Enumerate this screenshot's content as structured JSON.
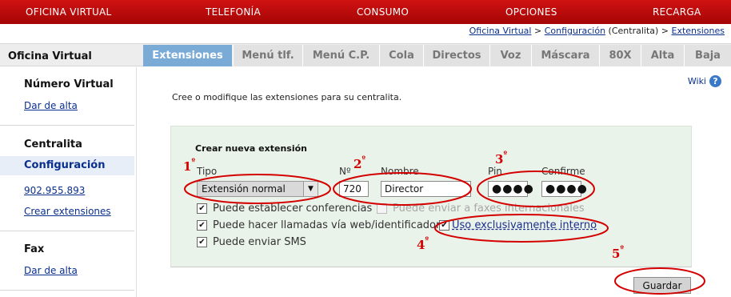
{
  "topnav": [
    "OFICINA VIRTUAL",
    "TELEFONÍA",
    "CONSUMO",
    "OPCIONES",
    "RECARGA"
  ],
  "breadcrumb": {
    "oficina": "Oficina Virtual",
    "sep1": " > ",
    "config": "Configuración",
    "centralita": " (Centralita) > ",
    "extensiones": "Extensiones"
  },
  "sidebar": {
    "title": "Oficina Virtual",
    "numero_virtual": "Número Virtual",
    "dar_alta_1": "Dar de alta",
    "centralita": "Centralita",
    "configuracion": "Configuración",
    "phone": "902.955.893",
    "crear_ext": "Crear extensiones",
    "fax": "Fax",
    "dar_alta_2": "Dar de alta"
  },
  "tabs": [
    "Extensiones",
    "Menú tlf.",
    "Menú C.P.",
    "Cola",
    "Directos",
    "Voz",
    "Máscara",
    "80X",
    "Alta",
    "Baja"
  ],
  "content": {
    "wiki": "Wiki",
    "intro": "Cree o modifique las extensiones para su centralita.",
    "panel_title": "Crear nueva extensión"
  },
  "form": {
    "tipo_label": "Tipo",
    "tipo_value": "Extensión normal",
    "num_label": "Nº",
    "num_value": "720",
    "nombre_label": "Nombre",
    "nombre_value": "Director",
    "pin_label": "Pin",
    "pin_value": "●●●●",
    "confirme_label": "Confirme",
    "confirme_value": "●●●●",
    "chk_conferencias": "Puede establecer conferencias",
    "chk_faxes": "Puede enviar a faxes internacionales",
    "chk_llamadas": "Puede hacer llamadas vía web/identificador",
    "chk_interno": "Uso exclusivamente interno",
    "chk_sms": "Puede enviar SMS",
    "save": "Guardar"
  },
  "annotations": {
    "n1": "1",
    "n2": "2",
    "n3": "3",
    "n4": "4",
    "n5": "5",
    "sup": "º",
    "color": "#d40000"
  },
  "colors": {
    "nav_red": "#c00808",
    "tab_active": "#7aaad6",
    "panel_bg": "#eaf3ea",
    "link": "#0a2f8c"
  }
}
